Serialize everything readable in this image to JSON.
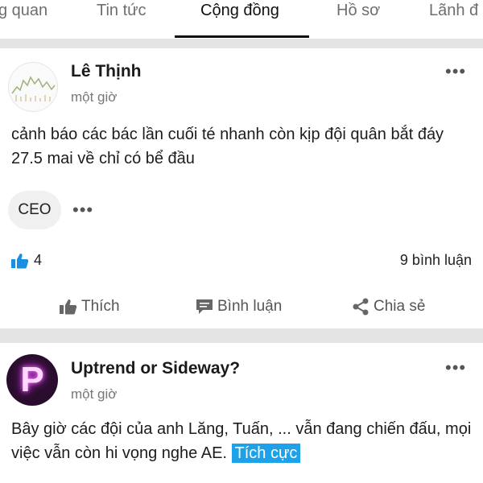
{
  "tabs": [
    {
      "label": "g quan"
    },
    {
      "label": "Tin tức"
    },
    {
      "label": "Cộng đồng"
    },
    {
      "label": "Hồ sơ"
    },
    {
      "label": "Lãnh đ"
    }
  ],
  "posts": [
    {
      "author": "Lê Thịnh",
      "time": "một giờ",
      "content": "cảnh báo các bác lần cuối té nhanh còn kịp đội quân bắt đáy 27.5 mai về chỉ có bể đầu",
      "chip": "CEO",
      "likes": "4",
      "comments": "9 bình luận",
      "actions": {
        "like": "Thích",
        "comment": "Bình luận",
        "share": "Chia sẻ"
      }
    },
    {
      "author": "Uptrend or Sideway?",
      "avatar_letter": "P",
      "time": "một giờ",
      "content": "Bây giờ các đội của anh Lăng, Tuấn, ... vẫn đang chiến đấu, mọi việc vẫn còn hi vọng nghe AE.",
      "tag": "Tích cực"
    }
  ],
  "colors": {
    "accent": "#1da1e8",
    "like_icon": "#1a8fe0"
  }
}
